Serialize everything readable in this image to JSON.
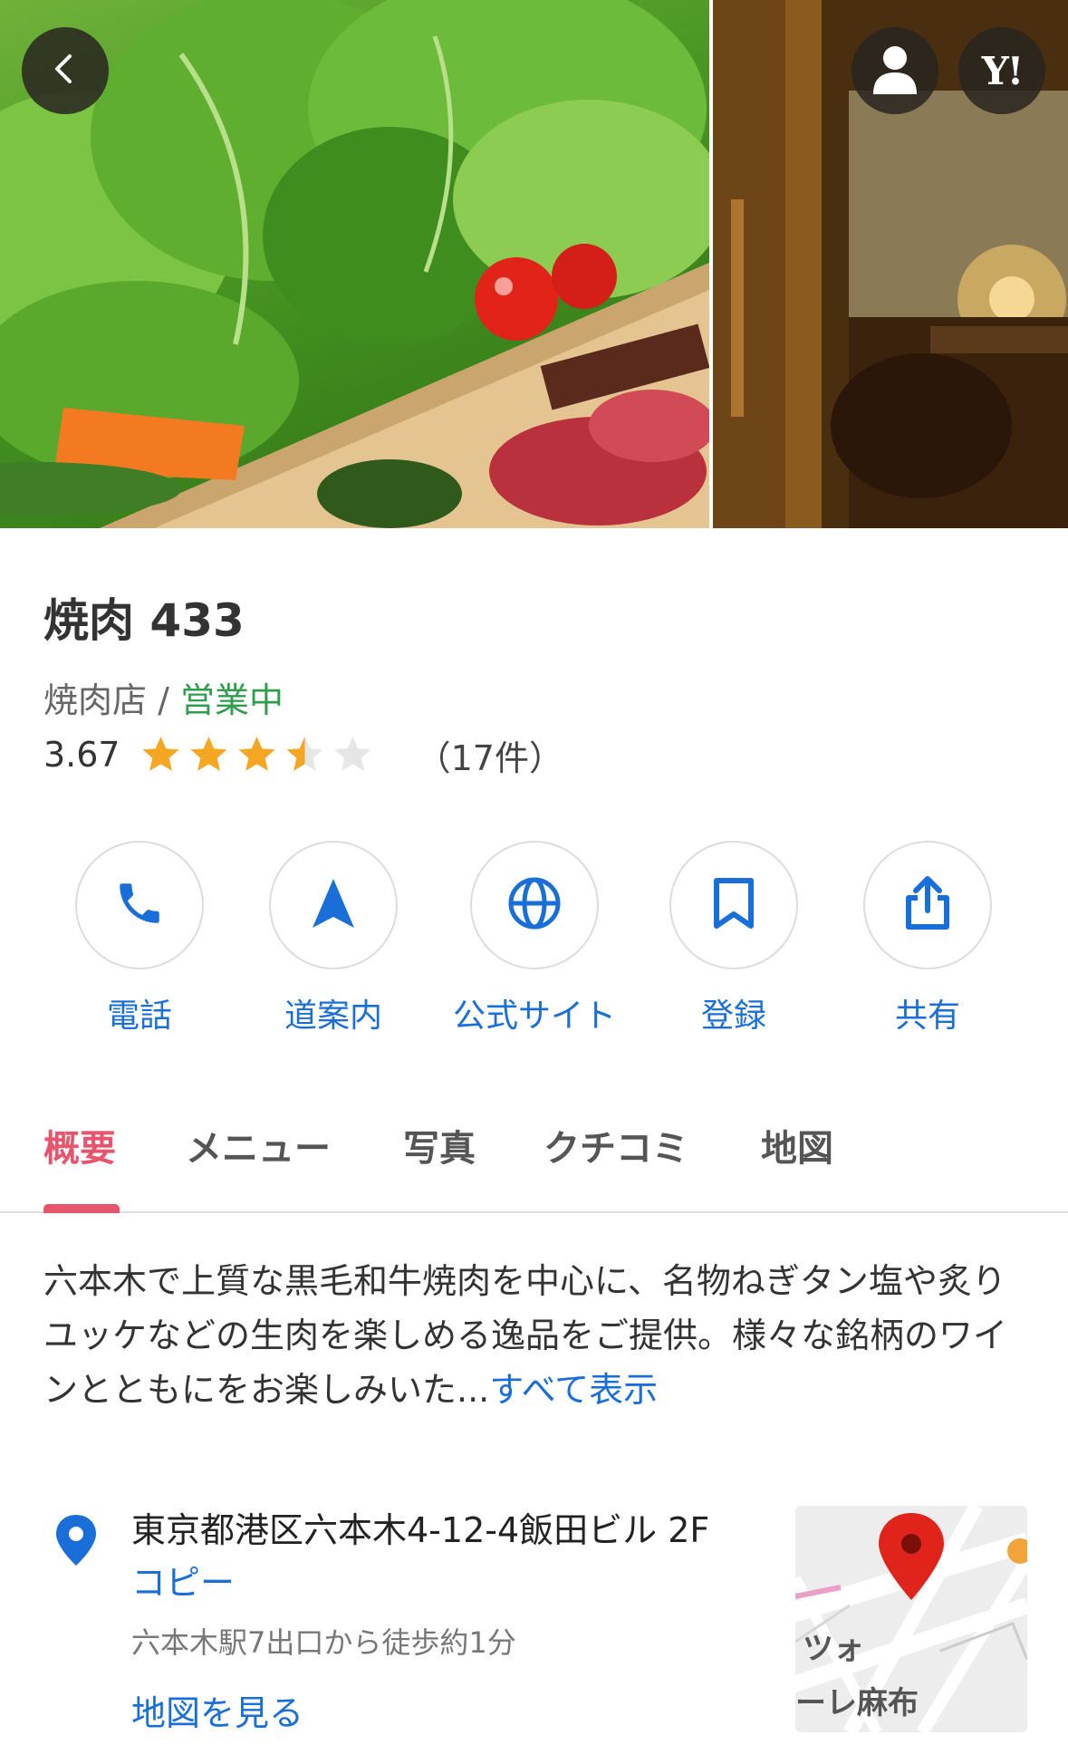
{
  "header": {
    "back_icon": "chevron-left-icon",
    "user_icon": "user-icon",
    "yahoo_label": "Y!"
  },
  "place": {
    "name": "焼肉 433",
    "category": "焼肉店",
    "separator": " / ",
    "status": "営業中",
    "rating": "3.67",
    "rating_value": 3.67,
    "rating_max": 5,
    "review_count": "（17件）"
  },
  "actions": [
    {
      "label": "電話",
      "icon": "phone-icon"
    },
    {
      "label": "道案内",
      "icon": "navigation-arrow-icon"
    },
    {
      "label": "公式サイト",
      "icon": "globe-icon"
    },
    {
      "label": "登録",
      "icon": "bookmark-icon"
    },
    {
      "label": "共有",
      "icon": "share-icon"
    }
  ],
  "tabs": [
    {
      "label": "概要",
      "active": true
    },
    {
      "label": "メニュー",
      "active": false
    },
    {
      "label": "写真",
      "active": false
    },
    {
      "label": "クチコミ",
      "active": false
    },
    {
      "label": "地図",
      "active": false
    }
  ],
  "description": {
    "text": "六本木で上質な黒毛和牛焼肉を中心に、名物ねぎタン塩や炙りユッケなどの生肉を楽しめる逸品をご提供。様々な銘柄のワインとともにをお楽しみいた...",
    "more_label": "すべて表示"
  },
  "address": {
    "line": "東京都港区六本木4-12-4飯田ビル 2F",
    "copy_label": "コピー",
    "access": "六本木駅7出口から徒歩約1分",
    "map_label": "地図を見る",
    "map_text_1": "ツォ",
    "map_text_2": "ーレ麻布"
  },
  "colors": {
    "accent_blue": "#1a6ed8",
    "open_green": "#2e9e4c",
    "tab_active": "#e8546c",
    "star_gold": "#f5a623"
  }
}
